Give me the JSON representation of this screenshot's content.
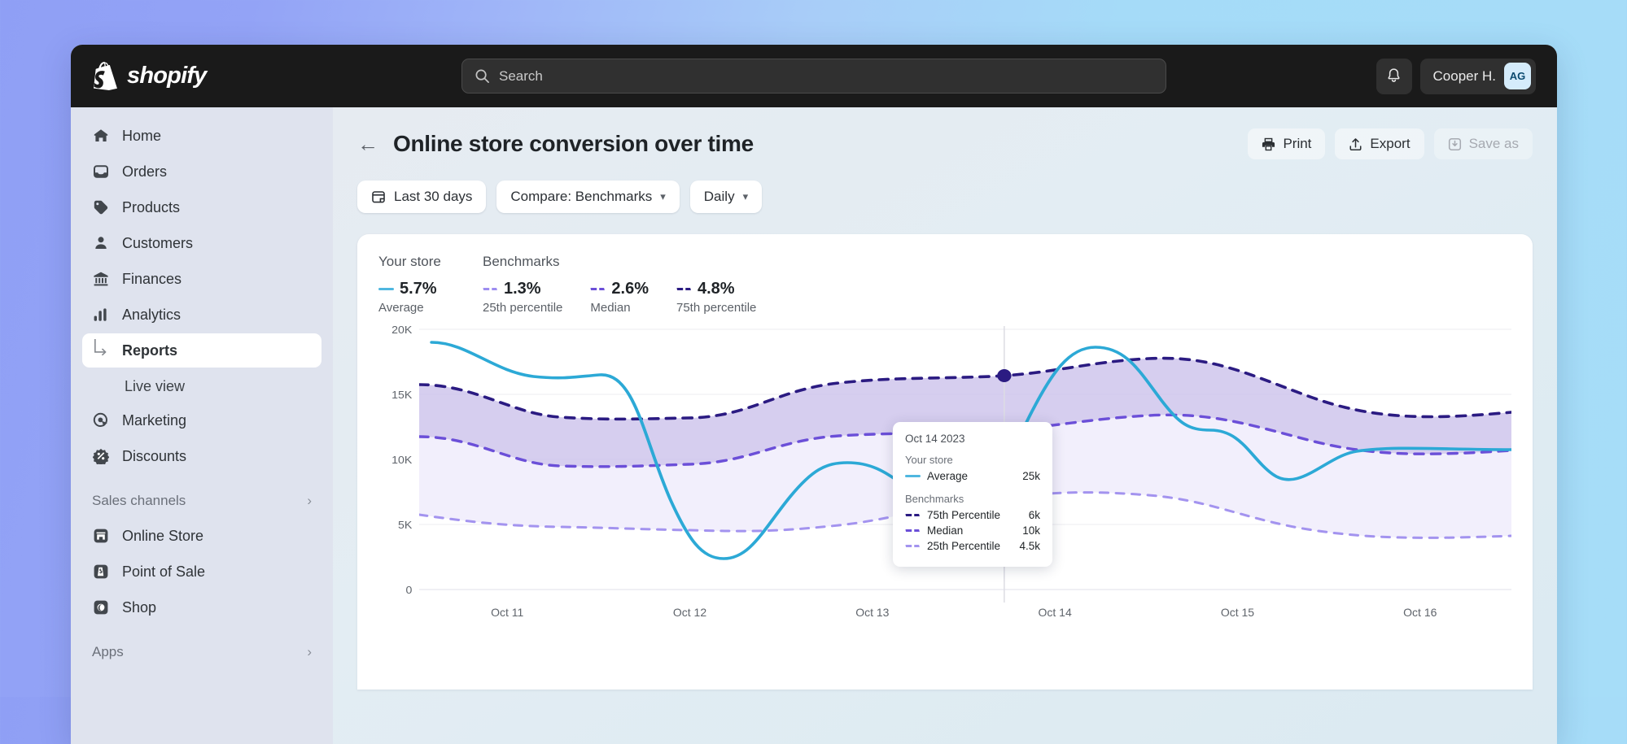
{
  "topbar": {
    "brand": "shopify",
    "search": {
      "placeholder": "Search",
      "value": ""
    },
    "bell_icon": "bell-icon",
    "user_name": "Cooper H.",
    "user_initials": "AG"
  },
  "sidebar": {
    "items": [
      {
        "label": "Home",
        "icon": "home-icon",
        "active": false
      },
      {
        "label": "Orders",
        "icon": "orders-icon",
        "active": false
      },
      {
        "label": "Products",
        "icon": "tag-icon",
        "active": false
      },
      {
        "label": "Customers",
        "icon": "person-icon",
        "active": false
      },
      {
        "label": "Finances",
        "icon": "bank-icon",
        "active": false
      },
      {
        "label": "Analytics",
        "icon": "bar-chart-icon",
        "active": false
      },
      {
        "label": "Reports",
        "icon": "arrow-sub-icon",
        "active": true
      },
      {
        "label": "Live view",
        "icon": "none",
        "active": false
      },
      {
        "label": "Marketing",
        "icon": "target-icon",
        "active": false
      },
      {
        "label": "Discounts",
        "icon": "percent-icon",
        "active": false
      }
    ],
    "sales_channels": {
      "label": "Sales channels",
      "chevron": "chevron-right-icon",
      "items": [
        {
          "label": "Online Store",
          "icon": "store-icon"
        },
        {
          "label": "Point of Sale",
          "icon": "pos-icon"
        },
        {
          "label": "Shop",
          "icon": "shop-icon"
        }
      ]
    },
    "apps": {
      "label": "Apps",
      "chevron": "chevron-right-icon"
    }
  },
  "page": {
    "back_icon": "arrow-left-icon",
    "title": "Online store conversion over time",
    "actions": [
      {
        "label": "Print",
        "icon": "printer-icon",
        "disabled": false
      },
      {
        "label": "Export",
        "icon": "upload-icon",
        "disabled": false
      },
      {
        "label": "Save as",
        "icon": "save-icon",
        "disabled": true
      }
    ],
    "filters": [
      {
        "label": "Last 30 days",
        "icon": "calendar-icon",
        "chevron": false
      },
      {
        "label": "Compare: Benchmarks",
        "icon": "none",
        "chevron": true
      },
      {
        "label": "Daily",
        "icon": "none",
        "chevron": true
      }
    ]
  },
  "legend": {
    "your_store_label": "Your store",
    "benchmarks_label": "Benchmarks",
    "metrics": [
      {
        "value": "5.7%",
        "sub": "Average",
        "style": "solid",
        "color": "#4fb7e0"
      },
      {
        "value": "1.3%",
        "sub": "25th percentile",
        "style": "dashed",
        "color": "#9d8df0"
      },
      {
        "value": "2.6%",
        "sub": "Median",
        "style": "dashed",
        "color": "#6b4fd8"
      },
      {
        "value": "4.8%",
        "sub": "75th percentile",
        "style": "dashed",
        "color": "#2b1b82"
      }
    ]
  },
  "tooltip": {
    "date": "Oct 14 2023",
    "your_store_label": "Your store",
    "benchmarks_label": "Benchmarks",
    "rows_store": [
      {
        "label": "Average",
        "value": "25k",
        "style": "solid",
        "color": "#4fb7e0"
      }
    ],
    "rows_bench": [
      {
        "label": "75th Percentile",
        "value": "6k",
        "style": "dashed",
        "color": "#2b1b82"
      },
      {
        "label": "Median",
        "value": "10k",
        "style": "dashed",
        "color": "#6b4fd8"
      },
      {
        "label": "25th Percentile",
        "value": "4.5k",
        "style": "dashed",
        "color": "#9d8df0"
      }
    ]
  },
  "chart_data": {
    "type": "line",
    "title": "Online store conversion over time",
    "xlabel": "",
    "ylabel": "",
    "grid": true,
    "legend_position": "top-left",
    "x": [
      "Oct 11",
      "Oct 12",
      "Oct 13",
      "Oct 14",
      "Oct 15",
      "Oct 16"
    ],
    "xtick_labels": [
      "Oct 11",
      "Oct 12",
      "Oct 13",
      "Oct 14",
      "Oct 15",
      "Oct 16"
    ],
    "ytick_labels": [
      "0",
      "5K",
      "10K",
      "15K",
      "20K"
    ],
    "ytick_values": [
      0,
      5000,
      10000,
      15000,
      20000
    ],
    "ylim": [
      0,
      20000
    ],
    "hover_x": "Oct 14",
    "series": [
      {
        "name": "Average",
        "group": "Your store",
        "style": "solid",
        "color": "#38b0dd",
        "values": [
          18300,
          17100,
          16900,
          8800,
          3700,
          9300,
          10200,
          9200,
          19800,
          14800,
          10400,
          9000
        ]
      },
      {
        "name": "75th Percentile",
        "group": "Benchmarks",
        "style": "dashed",
        "color": "#2b1b82",
        "values": [
          15100,
          14600,
          12400,
          12300,
          12500,
          14300,
          14900,
          15000,
          16600,
          15900,
          12300,
          11500
        ]
      },
      {
        "name": "Median",
        "group": "Benchmarks",
        "style": "dashed",
        "color": "#6b4fd8",
        "values": [
          11700,
          11400,
          9100,
          9000,
          9600,
          11300,
          11400,
          11200,
          12500,
          12100,
          10200,
          9600
        ]
      },
      {
        "name": "25th Percentile",
        "group": "Benchmarks",
        "style": "dashed",
        "color": "#a393ef",
        "values": [
          5600,
          5200,
          4600,
          4500,
          4800,
          6400,
          6900,
          6600,
          7100,
          6900,
          5400,
          5100
        ]
      }
    ],
    "bands": [
      {
        "name": "75th-Median band",
        "upper": "75th Percentile",
        "lower": "Median",
        "fill": "#cfc6ec"
      },
      {
        "name": "Median-25th band",
        "upper": "Median",
        "lower": "25th Percentile",
        "fill": "#f1edfb"
      }
    ],
    "marker": {
      "series": "75th Percentile",
      "x": "Oct 14",
      "color": "#2b1b82"
    }
  }
}
